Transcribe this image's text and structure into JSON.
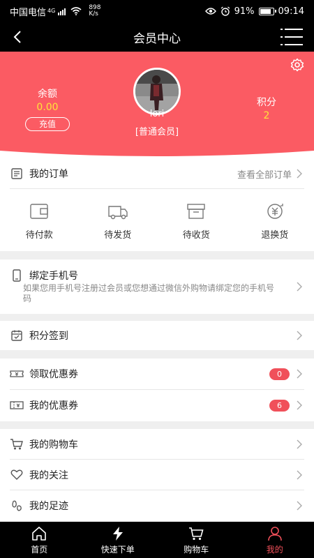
{
  "status_bar": {
    "carrier": "中国电信",
    "network": "4G",
    "speed_value": "898",
    "speed_unit": "K/s",
    "battery": "91%",
    "battery_level": 0.91,
    "time": "09:14"
  },
  "nav": {
    "title": "会员中心"
  },
  "profile": {
    "balance_label": "余额",
    "balance_value": "0.00",
    "recharge_label": "充值",
    "username": "lori",
    "level": "[普通会员]",
    "points_label": "积分",
    "points_value": "2"
  },
  "orders": {
    "title": "我的订单",
    "view_all": "查看全部订单",
    "items": [
      {
        "label": "待付款",
        "icon": "wallet-icon"
      },
      {
        "label": "待发货",
        "icon": "truck-icon"
      },
      {
        "label": "待收货",
        "icon": "box-icon"
      },
      {
        "label": "退换货",
        "icon": "refund-icon"
      }
    ]
  },
  "bind_phone": {
    "title": "绑定手机号",
    "desc": "如果您用手机号注册过会员或您想通过微信外购物请绑定您的手机号码"
  },
  "sign_in": {
    "title": "积分签到"
  },
  "coupons": {
    "get_label": "领取优惠券",
    "get_badge": "0",
    "mine_label": "我的优惠券",
    "mine_badge": "6"
  },
  "misc": {
    "cart": "我的购物车",
    "follow": "我的关注",
    "footprint": "我的足迹"
  },
  "tabbar": {
    "items": [
      {
        "label": "首页",
        "icon": "home-icon"
      },
      {
        "label": "快速下单",
        "icon": "lightning-icon"
      },
      {
        "label": "购物车",
        "icon": "cart-icon"
      },
      {
        "label": "我的",
        "icon": "user-icon"
      }
    ],
    "active_index": 3
  },
  "colors": {
    "accent": "#f0505a",
    "hero": "#fb5b63",
    "highlight": "#ffe43a"
  }
}
